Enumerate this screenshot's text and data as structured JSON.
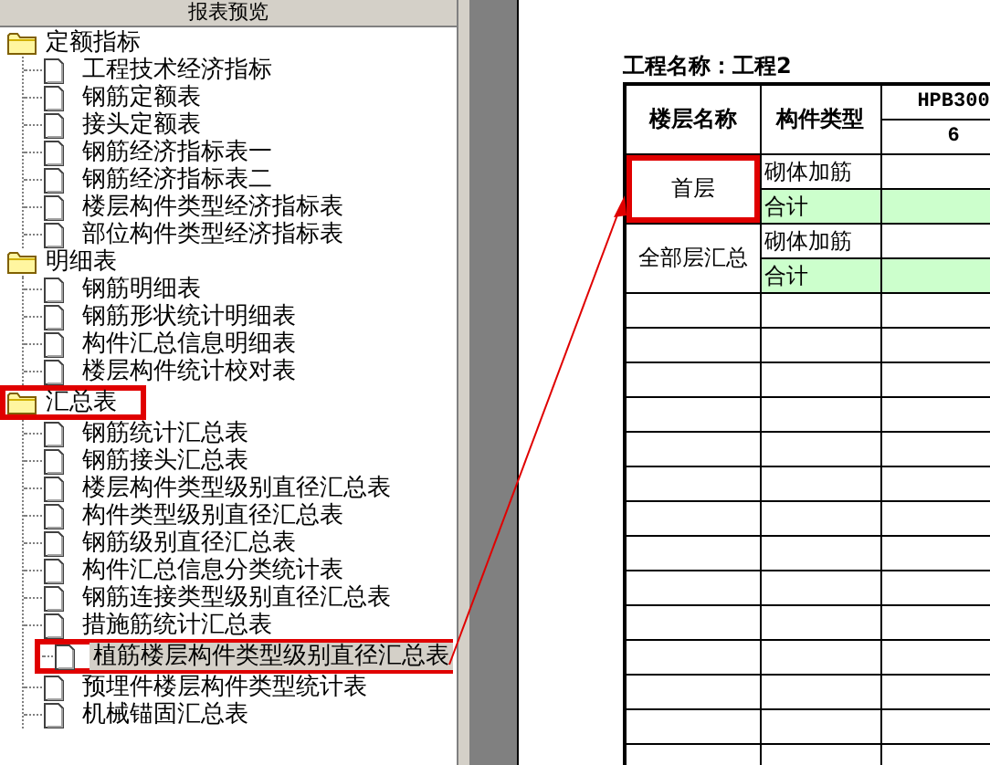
{
  "panel": {
    "title": "报表预览"
  },
  "tree": [
    {
      "label": "定额指标",
      "highlighted": false,
      "children": [
        {
          "label": "工程技术经济指标",
          "selected": false,
          "highlighted": false
        },
        {
          "label": "钢筋定额表",
          "selected": false,
          "highlighted": false
        },
        {
          "label": "接头定额表",
          "selected": false,
          "highlighted": false
        },
        {
          "label": "钢筋经济指标表一",
          "selected": false,
          "highlighted": false
        },
        {
          "label": "钢筋经济指标表二",
          "selected": false,
          "highlighted": false
        },
        {
          "label": "楼层构件类型经济指标表",
          "selected": false,
          "highlighted": false
        },
        {
          "label": "部位构件类型经济指标表",
          "selected": false,
          "highlighted": false
        }
      ]
    },
    {
      "label": "明细表",
      "highlighted": false,
      "children": [
        {
          "label": "钢筋明细表",
          "selected": false,
          "highlighted": false
        },
        {
          "label": "钢筋形状统计明细表",
          "selected": false,
          "highlighted": false
        },
        {
          "label": "构件汇总信息明细表",
          "selected": false,
          "highlighted": false
        },
        {
          "label": "楼层构件统计校对表",
          "selected": false,
          "highlighted": false
        }
      ]
    },
    {
      "label": "汇总表",
      "highlighted": true,
      "children": [
        {
          "label": "钢筋统计汇总表",
          "selected": false,
          "highlighted": false
        },
        {
          "label": "钢筋接头汇总表",
          "selected": false,
          "highlighted": false
        },
        {
          "label": "楼层构件类型级别直径汇总表",
          "selected": false,
          "highlighted": false
        },
        {
          "label": "构件类型级别直径汇总表",
          "selected": false,
          "highlighted": false
        },
        {
          "label": "钢筋级别直径汇总表",
          "selected": false,
          "highlighted": false
        },
        {
          "label": "构件汇总信息分类统计表",
          "selected": false,
          "highlighted": false
        },
        {
          "label": "钢筋连接类型级别直径汇总表",
          "selected": false,
          "highlighted": false
        },
        {
          "label": "措施筋统计汇总表",
          "selected": false,
          "highlighted": false
        },
        {
          "label": "植筋楼层构件类型级别直径汇总表",
          "selected": true,
          "highlighted": true
        },
        {
          "label": "预埋件楼层构件类型统计表",
          "selected": false,
          "highlighted": false
        },
        {
          "label": "机械锚固汇总表",
          "selected": false,
          "highlighted": false
        }
      ]
    }
  ],
  "report": {
    "title": "工程名称：工程2",
    "columns": [
      "楼层名称",
      "构件类型"
    ],
    "group_header": "HPB300",
    "sub_header": "6",
    "rows": [
      {
        "floor": "首层",
        "highlighted": true,
        "lines": [
          {
            "type": "砌体加筋",
            "kind": "item"
          },
          {
            "type": "合计",
            "kind": "total"
          }
        ]
      },
      {
        "floor": "全部层汇总",
        "highlighted": false,
        "lines": [
          {
            "type": "砌体加筋",
            "kind": "item"
          },
          {
            "type": "合计",
            "kind": "total"
          }
        ]
      }
    ]
  }
}
